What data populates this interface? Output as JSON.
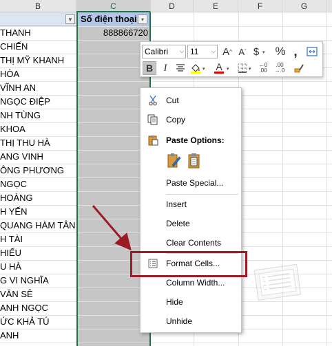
{
  "columns": [
    "B",
    "C",
    "D",
    "E",
    "F",
    "G"
  ],
  "header_row": {
    "colC": "Số điện thoại"
  },
  "phone_value": "888866720",
  "names": [
    "THANH",
    "CHIẾN",
    "THỊ MỸ KHANH",
    "HÒA",
    "VĨNH AN",
    "NGỌC ĐIỆP",
    "NH TÙNG",
    "KHOA",
    "THỊ THU HÀ",
    "ANG VINH",
    "ÔNG PHƯƠNG",
    "NGỌC",
    "HOÀNG",
    "H YẾN",
    "QUANG HÀM TÂN",
    "H TÀI",
    "HIẾU",
    "U HÀ",
    "G VI NGHĨA",
    "VĂN SÊ",
    "ANH NGỌC",
    "ỨC KHẢ TÚ",
    "ANH"
  ],
  "toolbar": {
    "font_name": "Calibri",
    "font_size": "11",
    "grow_font": "A",
    "shrink_font": "A",
    "currency": "$",
    "percent": "%",
    "comma": ",",
    "bold": "B",
    "italic": "I",
    "font_color_letter": "A",
    "decrease_dec": ".00",
    "increase_dec": ".0"
  },
  "menu": {
    "cut": "Cut",
    "copy": "Copy",
    "paste_options": "Paste Options:",
    "paste_special": "Paste Special...",
    "insert": "Insert",
    "delete": "Delete",
    "clear_contents": "Clear Contents",
    "format_cells": "Format Cells...",
    "column_width": "Column Width...",
    "hide": "Hide",
    "unhide": "Unhide"
  },
  "colors": {
    "accent_green": "#217346",
    "highlight_red": "#9b1b27",
    "header_blue": "#b4c6e7",
    "selection_gray": "#c6c6c6"
  },
  "icons": {
    "cut": "scissors-icon",
    "copy": "copy-icon",
    "paste": "clipboard-icon",
    "format_cells": "format-cells-icon"
  }
}
